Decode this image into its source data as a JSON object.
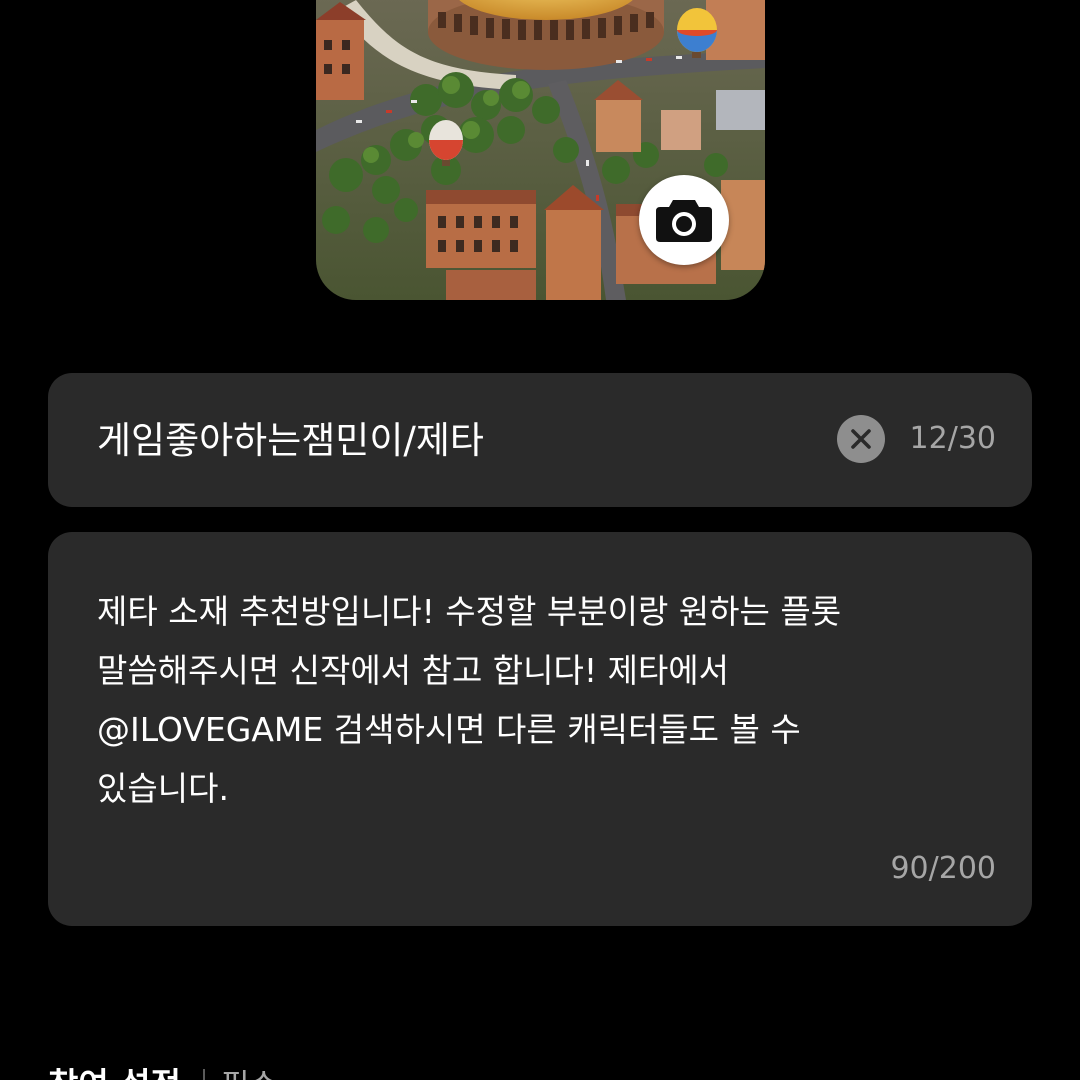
{
  "cover": {
    "image_alt": "city illustration with colosseum and hot air balloons",
    "camera_icon": "camera-icon"
  },
  "name_field": {
    "value": "게임좋아하는잼민이/제타",
    "counter": "12/30",
    "clear_icon": "close-icon"
  },
  "description_field": {
    "value": "제타 소재 추천방입니다! 수정할 부분이랑 원하는 플롯\n말씀해주시면 신작에서 참고 합니다! 제타에서\n@ILOVEGAME 검색하시면 다른 캐릭터들도 볼 수\n있습니다.",
    "counter": "90/200"
  },
  "participation_section": {
    "title": "참여 설정",
    "subtitle": "필수"
  },
  "colors": {
    "background": "#000000",
    "field_background": "#2a2a2a",
    "counter_text": "#a6a6a6",
    "clear_button": "#8e8e8e"
  }
}
